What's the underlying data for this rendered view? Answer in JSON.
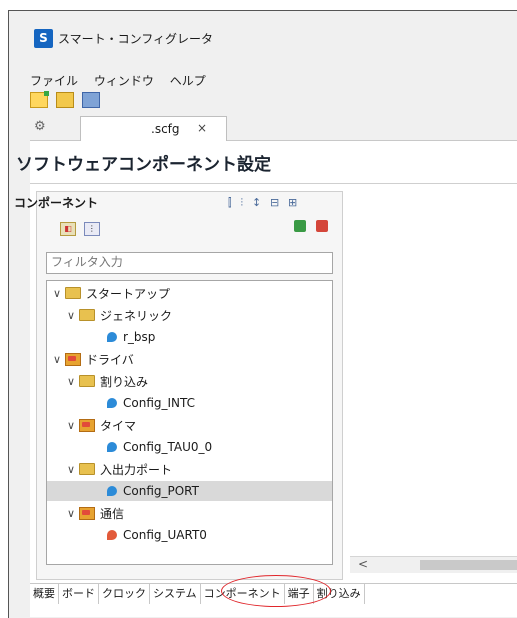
{
  "window": {
    "title": "スマート・コンフィグレータ",
    "icon": "smart-configurator-app-icon"
  },
  "menu": [
    "ファイル",
    "ウィンドウ",
    "ヘルプ"
  ],
  "editor_tab": {
    "label": ".scfg",
    "close": "×"
  },
  "page_title": "ソフトウェアコンポーネント設定",
  "panel": {
    "title": "コンポーネント",
    "filter_placeholder": "フィルタ入力"
  },
  "tree": [
    {
      "label": "スタートアップ",
      "level": 0,
      "type": "folder",
      "chev": "∨"
    },
    {
      "label": "ジェネリック",
      "level": 1,
      "type": "folder",
      "chev": "∨"
    },
    {
      "label": "r_bsp",
      "level": 2,
      "type": "component"
    },
    {
      "label": "ドライバ",
      "level": 0,
      "type": "package",
      "chev": "∨"
    },
    {
      "label": "割り込み",
      "level": 1,
      "type": "folder",
      "chev": "∨"
    },
    {
      "label": "Config_INTC",
      "level": 2,
      "type": "component"
    },
    {
      "label": "タイマ",
      "level": 1,
      "type": "package",
      "chev": "∨"
    },
    {
      "label": "Config_TAU0_0",
      "level": 2,
      "type": "component"
    },
    {
      "label": "入出力ポート",
      "level": 1,
      "type": "folder",
      "chev": "∨"
    },
    {
      "label": "Config_PORT",
      "level": 2,
      "type": "component",
      "selected": true
    },
    {
      "label": "通信",
      "level": 1,
      "type": "package",
      "chev": "∨"
    },
    {
      "label": "Config_UART0",
      "level": 2,
      "type": "component-red"
    }
  ],
  "bottom_tabs": [
    "概要",
    "ボード",
    "クロック",
    "システム",
    "コンポーネント",
    "端子",
    "割り込み"
  ],
  "active_bottom_tab": "コンポーネント",
  "scroll_left_arrow": "<",
  "highlight_color": "#e0262b"
}
